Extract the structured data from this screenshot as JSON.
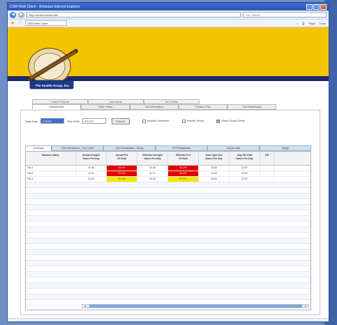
{
  "window": {
    "title": "CSW Web Client - Windows Internet Explorer",
    "address": "http://localhost/csw.htm",
    "search_placeholder": "Live Search",
    "page_tab": "CSW Web Client",
    "tools": [
      "Page",
      "Tools"
    ]
  },
  "logo": {
    "text": "The Seattle Group, Inc."
  },
  "top_tabs": [
    "Custom Reports",
    "User Admin",
    "Dev Panels"
  ],
  "main_tabs": [
    {
      "label": "Unwatchable",
      "active": true
    },
    {
      "label": "Order Setup",
      "active": false
    },
    {
      "label": "Tool Information",
      "active": false
    },
    {
      "label": "Product Plan",
      "active": false
    },
    {
      "label": "Tool Dashboard",
      "active": false
    }
  ],
  "filters": {
    "start_label": "Start Date",
    "start_value": "7/20/07",
    "stop_label": "Stop Date",
    "stop_value": "7/27/07",
    "refresh_label": "Refresh",
    "checks": [
      {
        "label": "Include Downtime",
        "checked": false
      },
      {
        "label": "Include Setup",
        "checked": false
      },
      {
        "label": "Show Group Detail",
        "checked": true
      }
    ]
  },
  "sub_tabs": [
    {
      "label": "Summary",
      "active": true
    },
    {
      "label": "Over Breakdown - Tool Level",
      "active": false
    },
    {
      "label": "Over Breakdown - Group",
      "active": false
    },
    {
      "label": "OPP Breakdown",
      "active": false
    },
    {
      "label": "Actual Data",
      "active": false
    },
    {
      "label": "Graph",
      "active": false
    }
  ],
  "grid": {
    "headers": [
      "Machine Name",
      "Actual Uneight\nHours Per Day",
      "Actual Pct\nOf Goal",
      "Effective Uneight\nHours Per Day",
      "Effective Pct\nOf Goal",
      "Goal Light Out\nHours Per Day",
      "Avg Off Shift\nHours Per Day",
      "Off"
    ],
    "rows": [
      {
        "cells": [
          "TM-1",
          "11.48",
          "84.4%",
          "12.40",
          "91.2%",
          "13.60",
          "12.67",
          ""
        ],
        "status": [
          "",
          "",
          "red",
          "",
          "red",
          "",
          "",
          ""
        ]
      },
      {
        "cells": [
          "TM-2",
          "11.91",
          "87.5%",
          "11.77",
          "86.5%",
          "13.60",
          "12.67",
          ""
        ],
        "status": [
          "",
          "",
          "red",
          "",
          "red",
          "",
          "",
          ""
        ]
      },
      {
        "cells": [
          "TM-3",
          "13.21",
          "97.1%",
          "13.25",
          "97.4%",
          "13.60",
          "12.67",
          ""
        ],
        "status": [
          "",
          "",
          "yellow",
          "",
          "yellow",
          "",
          "",
          ""
        ]
      }
    ]
  },
  "colors": {
    "banner": "#f5c400",
    "navy": "#1c2a6e",
    "bad": "#e20000",
    "warn": "#f8e600"
  }
}
